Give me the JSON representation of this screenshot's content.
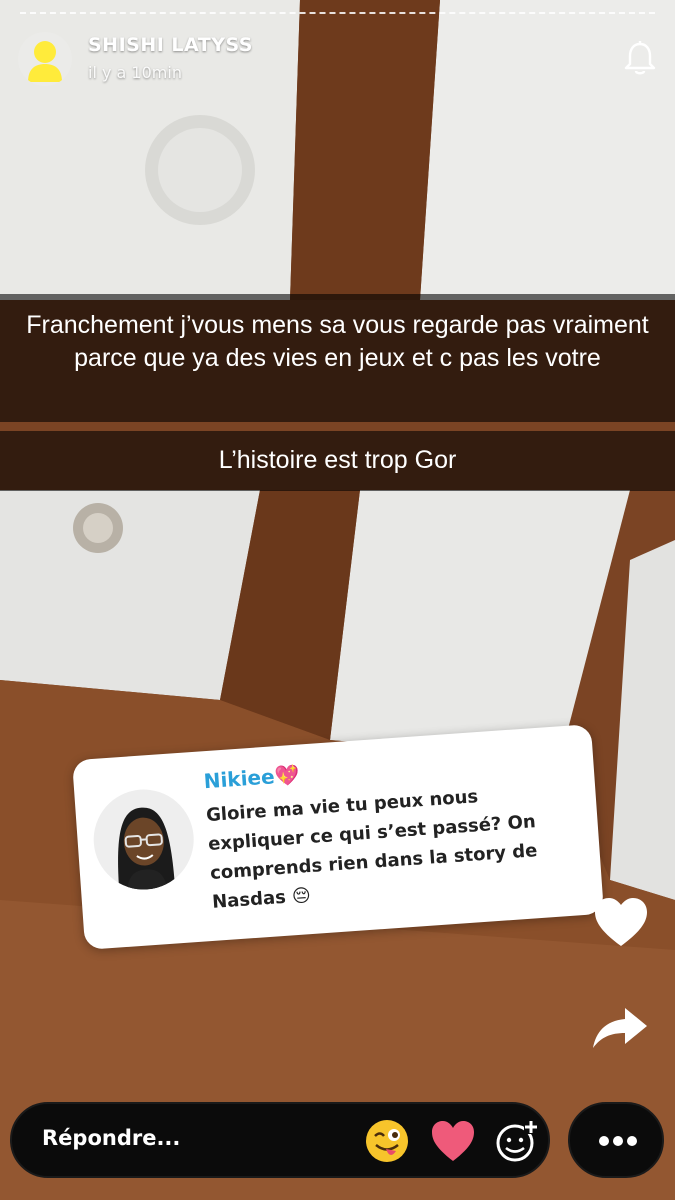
{
  "header": {
    "user_name": "SHISHI LATYSS",
    "time": "il y a 10min",
    "avatar_icon": "ghost-silhouette-icon",
    "notification_icon": "bell-icon"
  },
  "captions": [
    "Franchement j’vous mens sa vous regarde pas vraiment parce que ya des vies en jeux et c pas les votre",
    "L’histoire est trop Gor"
  ],
  "reply_sticker": {
    "sender": "Nikiee💖",
    "message": "Gloire ma vie tu peux nous expliquer ce qui s’est passé? On comprends rien dans la story de Nasdas 😔",
    "avatar_icon": "bitmoji-avatar"
  },
  "actions": {
    "like_icon": "heart-icon",
    "share_icon": "share-arrow-icon"
  },
  "reply_bar": {
    "placeholder": "Répondre...",
    "emoji_icons": [
      "tongue-wink-emoji",
      "heart-emoji",
      "add-sticker-icon"
    ],
    "more_icon": "more-dots-icon"
  },
  "colors": {
    "accent_name": "#2a9fd8",
    "avatar_yellow": "#ffeb3b"
  }
}
